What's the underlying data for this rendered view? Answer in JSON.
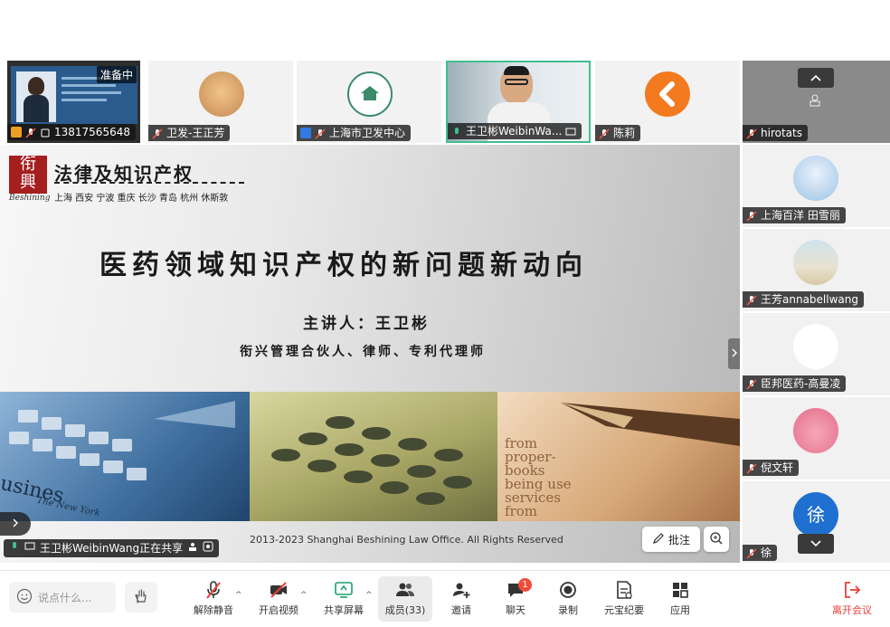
{
  "tiles": [
    {
      "name": "13817565648",
      "badge": "准备中"
    },
    {
      "name": "卫发-王正芳"
    },
    {
      "name": "上海市卫发中心"
    },
    {
      "name": "王卫彬WeibinWa..."
    },
    {
      "name": "陈莉"
    },
    {
      "name": "hirotats"
    }
  ],
  "sidebar": {
    "participants": [
      {
        "name": "上海百洋 田雪丽"
      },
      {
        "name": "王芳annabellwang"
      },
      {
        "name": "臣邦医药-高曼凌"
      },
      {
        "name": "倪文轩"
      },
      {
        "name": "徐",
        "avatar_text": "徐"
      }
    ]
  },
  "slide": {
    "logo_top": "衔",
    "logo_bottom": "興",
    "logo_script": "Beshining",
    "firm_title": "法律及知识产权",
    "cities": "上海 西安 宁波 重庆 长沙 青岛 杭州 休斯敦",
    "main_title": "医药领域知识产权的新问题新动向",
    "speaker": "主讲人：王卫彬",
    "speaker_title": "衔兴管理合伙人、律师、专利代理师",
    "footer": "2013-2023 Shanghai Beshining Law Office. All Rights Reserved",
    "photo2_text_1": "usines",
    "photo2_text_2": "The New York",
    "photo3_text": "from\nproper-\nbooks\nbeing use\nservices\nfrom"
  },
  "sharing_status": "王卫彬WeibinWang正在共享",
  "annotate_label": "批注",
  "toolbar": {
    "chat_placeholder": "说点什么...",
    "buttons": [
      {
        "label": "解除静音"
      },
      {
        "label": "开启视频"
      },
      {
        "label": "共享屏幕"
      },
      {
        "label": "成员(33)"
      },
      {
        "label": "邀请"
      },
      {
        "label": "聊天",
        "badge": "1"
      },
      {
        "label": "录制"
      },
      {
        "label": "元宝纪要"
      },
      {
        "label": "应用"
      },
      {
        "label": "离开会议"
      }
    ]
  },
  "colors": {
    "leave": "#e5403a",
    "active_border": "#3fbf8e",
    "badge_red": "#f04b3a",
    "avatar_blue": "#1f6fd1"
  }
}
